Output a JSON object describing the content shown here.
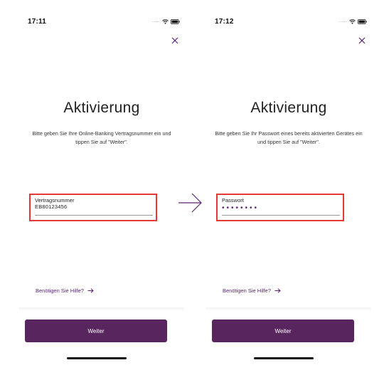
{
  "screens": [
    {
      "status_time": "17:11",
      "signal": ".....",
      "title": "Aktivierung",
      "description": "Bitte geben Sie Ihre Online-Banking Vertragsnummer ein und tippen Sie auf \"Weiter\".",
      "field": {
        "label": "Vertragsnummer",
        "value": "EB80123456"
      },
      "help_link": "Benötigen Sie Hilfe?",
      "button_label": "Weiter"
    },
    {
      "status_time": "17:12",
      "signal": ".....",
      "title": "Aktivierung",
      "description": "Bitte geben Sie Ihr Passwort eines bereits aktivierten Gerätes ein und tippen Sie auf \"Weiter\".",
      "field": {
        "label": "Passwort",
        "value": "••••••••"
      },
      "help_link": "Benötigen Sie Hilfe?",
      "button_label": "Weiter"
    }
  ],
  "colors": {
    "brand_purple": "#59255f",
    "link_purple": "#5a2470",
    "highlight_red": "#e53935"
  },
  "icons": {
    "close": "close-icon",
    "wifi": "wifi-icon",
    "battery": "battery-icon",
    "help_arrow": "arrow-right-icon",
    "flow_arrow": "flow-arrow-icon"
  }
}
